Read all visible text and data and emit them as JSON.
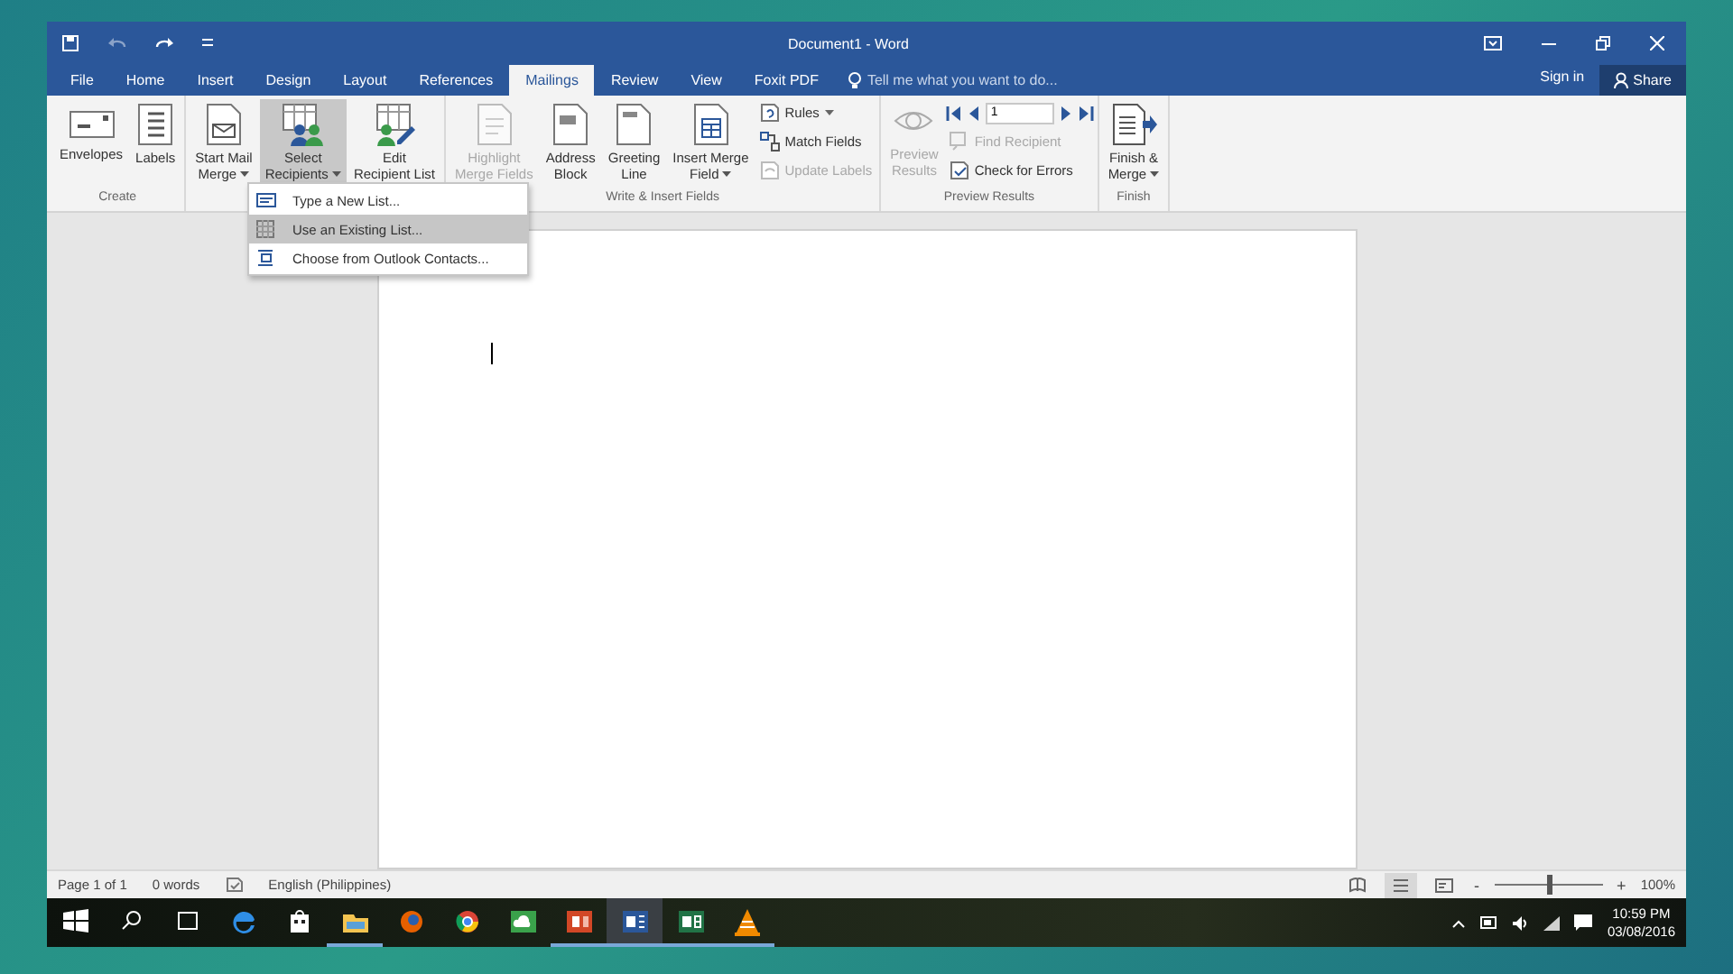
{
  "window": {
    "title": "Document1 - Word"
  },
  "tabs": [
    {
      "label": "File",
      "selected": false
    },
    {
      "label": "Home",
      "selected": false
    },
    {
      "label": "Insert",
      "selected": false
    },
    {
      "label": "Design",
      "selected": false
    },
    {
      "label": "Layout",
      "selected": false
    },
    {
      "label": "References",
      "selected": false
    },
    {
      "label": "Mailings",
      "selected": true
    },
    {
      "label": "Review",
      "selected": false
    },
    {
      "label": "View",
      "selected": false
    },
    {
      "label": "Foxit PDF",
      "selected": false
    }
  ],
  "tell_me": {
    "placeholder": "Tell me what you want to do..."
  },
  "account": {
    "sign_in": "Sign in",
    "share": "Share"
  },
  "ribbon": {
    "groups": [
      {
        "label": "Create",
        "items": [
          {
            "kind": "large",
            "lines": [
              "Envelopes"
            ],
            "dropdown": false,
            "disabled": false,
            "selected": false
          },
          {
            "kind": "large",
            "lines": [
              "Labels"
            ],
            "dropdown": false,
            "disabled": false,
            "selected": false
          }
        ]
      },
      {
        "items": [
          {
            "kind": "large",
            "lines": [
              "Start Mail",
              "Merge"
            ],
            "dropdown": true,
            "disabled": false,
            "selected": false
          },
          {
            "kind": "large",
            "lines": [
              "Select",
              "Recipients"
            ],
            "dropdown": true,
            "disabled": false,
            "selected": true
          },
          {
            "kind": "large",
            "lines": [
              "Edit",
              "Recipient List"
            ],
            "dropdown": false,
            "disabled": false,
            "selected": false
          }
        ]
      },
      {
        "label": "Write & Insert Fields",
        "items": [
          {
            "kind": "large",
            "lines": [
              "Highlight",
              "Merge Fields"
            ],
            "dropdown": false,
            "disabled": true,
            "selected": false
          },
          {
            "kind": "large",
            "lines": [
              "Address",
              "Block"
            ],
            "dropdown": false,
            "disabled": false,
            "selected": false
          },
          {
            "kind": "large",
            "lines": [
              "Greeting",
              "Line"
            ],
            "dropdown": false,
            "disabled": false,
            "selected": false
          },
          {
            "kind": "large",
            "lines": [
              "Insert Merge",
              "Field"
            ],
            "dropdown": true,
            "disabled": false,
            "selected": false
          },
          {
            "kind": "stack",
            "entries": [
              {
                "label": "Rules",
                "dropdown": true,
                "disabled": false
              },
              {
                "label": "Match Fields",
                "dropdown": false,
                "disabled": false
              },
              {
                "label": "Update Labels",
                "dropdown": false,
                "disabled": true
              }
            ]
          }
        ]
      },
      {
        "label": "Preview Results",
        "items": [
          {
            "kind": "large",
            "lines": [
              "Preview",
              "Results"
            ],
            "dropdown": false,
            "disabled": true,
            "selected": false
          },
          {
            "kind": "nav",
            "record": "1",
            "entries": [
              {
                "label": "Find Recipient",
                "dropdown": false,
                "disabled": true
              },
              {
                "label": "Check for Errors",
                "dropdown": false,
                "disabled": false
              }
            ]
          }
        ]
      },
      {
        "label": "Finish",
        "items": [
          {
            "kind": "large",
            "lines": [
              "Finish &",
              "Merge"
            ],
            "dropdown": true,
            "disabled": false,
            "selected": false
          }
        ]
      }
    ]
  },
  "menu": {
    "items": [
      {
        "label": "Type a New List...",
        "selected": false
      },
      {
        "label": "Use an Existing List...",
        "selected": true
      },
      {
        "label": "Choose from Outlook Contacts...",
        "selected": false
      }
    ]
  },
  "status_bar": {
    "page": "Page 1 of 1",
    "words": "0 words",
    "language": "English (Philippines)",
    "views": [
      {
        "selected": false
      },
      {
        "selected": true
      },
      {
        "selected": false
      }
    ],
    "zoom_out": "-",
    "zoom_in": "+",
    "zoom": {
      "level": 0.5
    },
    "zoom_reading": "100%"
  },
  "taskbar": {
    "apps": [
      {
        "running": false,
        "selected": false
      },
      {
        "running": false,
        "selected": false
      },
      {
        "running": true,
        "selected": false
      },
      {
        "running": false,
        "selected": false
      },
      {
        "running": false,
        "selected": false
      },
      {
        "running": false,
        "selected": false
      },
      {
        "running": true,
        "selected": false
      },
      {
        "running": true,
        "selected": true
      },
      {
        "running": true,
        "selected": false
      },
      {
        "running": true,
        "selected": false
      }
    ],
    "time": "10:59 PM",
    "date": "03/08/2016"
  }
}
